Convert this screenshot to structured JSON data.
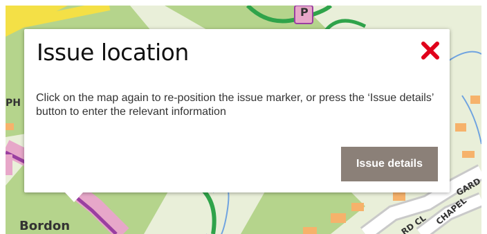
{
  "map": {
    "labels": {
      "place": "Bordon",
      "parking_marker": "P",
      "ph_left": "PH",
      "road_cl": "RD CL",
      "road_chapel": "CHAPEL",
      "road_garden": "GARD"
    },
    "colors": {
      "background": "#e9efd9",
      "woodland": "#b5d48c",
      "road_pink": "#e7a7c9",
      "road_purple": "#9a3fa0",
      "road_yellow": "#f4e046",
      "path_green": "#2fa34a",
      "water": "#6fa3e0",
      "building": "#f6b26b",
      "street": "#c9c9c9"
    }
  },
  "popup": {
    "title": "Issue location",
    "message": "Click on the map again to re-position the issue marker, or press the ‘Issue details’ button to enter the relevant information",
    "close_icon": "close-x-icon",
    "close_color": "#e0001b",
    "details_button": "Issue details",
    "details_button_color": "#8b8078"
  }
}
